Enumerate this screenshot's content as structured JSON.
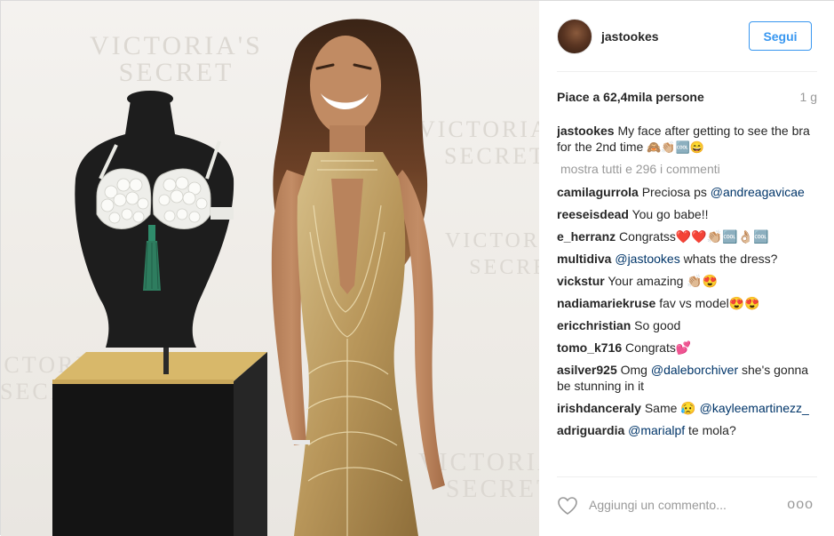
{
  "post": {
    "username": "jastookes",
    "follow_label": "Segui",
    "likes": "Piace a 62,4mila persone",
    "age": "1 g"
  },
  "photo": {
    "watermark": [
      "VICTORIA'S",
      "SECRET"
    ]
  },
  "caption": {
    "username": "jastookes",
    "text": "My face after getting to see the bra for the 2nd time",
    "emoji": "🙈👏🏼🆒😄"
  },
  "view_all": "mostra tutti e 296 i commenti",
  "comments": [
    {
      "user": "camilagurrola",
      "text": "Preciosa ps",
      "mention": "@andreagavicae",
      "after": ""
    },
    {
      "user": "reeseisdead",
      "text": "You go babe!!",
      "mention": "",
      "after": ""
    },
    {
      "user": "e_herranz",
      "text": "Congratss❤️❤️👏🏼🆒👌🏼🆒",
      "mention": "",
      "after": ""
    },
    {
      "user": "multidiva",
      "text": "",
      "mention": "@jastookes",
      "after": "whats the dress?"
    },
    {
      "user": "vickstur",
      "text": "Your amazing 👏🏼😍",
      "mention": "",
      "after": ""
    },
    {
      "user": "nadiamariekruse",
      "text": "fav vs model😍😍",
      "mention": "",
      "after": ""
    },
    {
      "user": "ericchristian",
      "text": "So good",
      "mention": "",
      "after": ""
    },
    {
      "user": "tomo_k716",
      "text": "Congrats💕",
      "mention": "",
      "after": ""
    },
    {
      "user": "asilver925",
      "text": "Omg",
      "mention": "@daleborchiver",
      "after": "she's gonna be stunning in it"
    },
    {
      "user": "irishdanceraly",
      "text": "Same 😥",
      "mention": "@kayleemartinezz_",
      "after": ""
    },
    {
      "user": "adriguardia",
      "text": "",
      "mention": "@marialpf",
      "after": "te mola?"
    }
  ],
  "footer": {
    "add_comment_placeholder": "Aggiungi un commento...",
    "more_label": "ooo"
  },
  "colors": {
    "accent": "#3897f0",
    "mention": "#003569",
    "muted": "#999999"
  }
}
